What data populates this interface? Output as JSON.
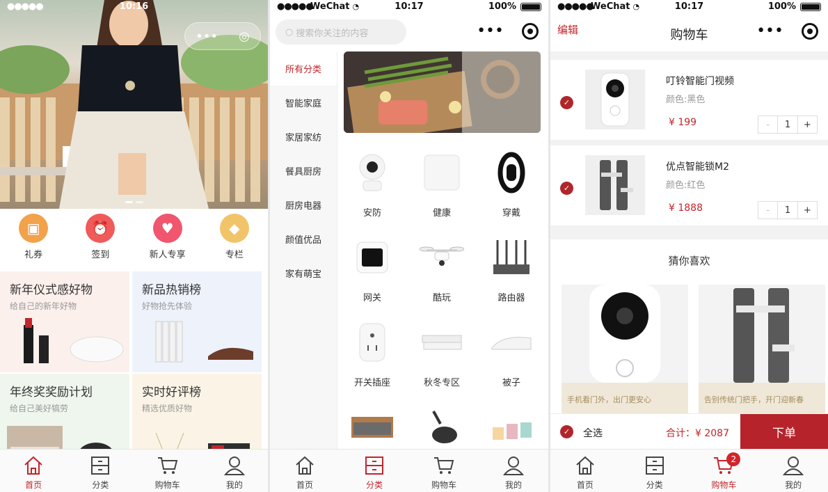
{
  "status": {
    "dots": "●●●●●",
    "carrier": "WeChat",
    "battery": "100%",
    "time1": "10:16",
    "time2": "10:17",
    "time3": "10:17"
  },
  "tabbar": {
    "home": "首页",
    "category": "分类",
    "cart": "购物车",
    "mine": "我的",
    "cart_badge": "2"
  },
  "home": {
    "quick": [
      {
        "label": "礼券",
        "icon": "coupon-icon",
        "color": "#f2a24a"
      },
      {
        "label": "签到",
        "icon": "alarm-clock-icon",
        "color": "#f05a5a"
      },
      {
        "label": "新人专享",
        "icon": "heart-icon",
        "color": "#f0566d"
      },
      {
        "label": "专栏",
        "icon": "diamond-icon",
        "color": "#f2c46a"
      }
    ],
    "promos": [
      {
        "title": "新年仪式感好物",
        "subtitle": "给自己的新年好物"
      },
      {
        "title": "新品热销榜",
        "subtitle": "好物抢先体验"
      },
      {
        "title": "年终奖奖励计划",
        "subtitle": "给自己美好犒劳"
      },
      {
        "title": "实时好评榜",
        "subtitle": "精选优质好物"
      }
    ]
  },
  "category": {
    "search_placeholder": "搜索你关注的内容",
    "sidebar": [
      "所有分类",
      "智能家庭",
      "家居家纺",
      "餐具厨房",
      "厨房电器",
      "颜值优品",
      "家有萌宝"
    ],
    "grid": [
      "安防",
      "健康",
      "穿戴",
      "网关",
      "酷玩",
      "路由器",
      "开关插座",
      "秋冬专区",
      "被子",
      "",
      "",
      ""
    ]
  },
  "cart": {
    "edit": "编辑",
    "title": "购物车",
    "items": [
      {
        "name": "叮铃智能门视频",
        "color": "颜色:黑色",
        "price": "¥ 199",
        "qty": "1"
      },
      {
        "name": "优点智能锁M2",
        "color": "颜色:红色",
        "price": "¥ 1888",
        "qty": "1"
      }
    ],
    "minus": "-",
    "plus": "+",
    "guess_title": "猜你喜欢",
    "guess": [
      {
        "caption": "手机看门外，出门更安心"
      },
      {
        "caption": "告别传统门把手，开门迎新春"
      }
    ],
    "select_all": "全选",
    "total": "合计：¥ 2087",
    "order": "下单"
  }
}
